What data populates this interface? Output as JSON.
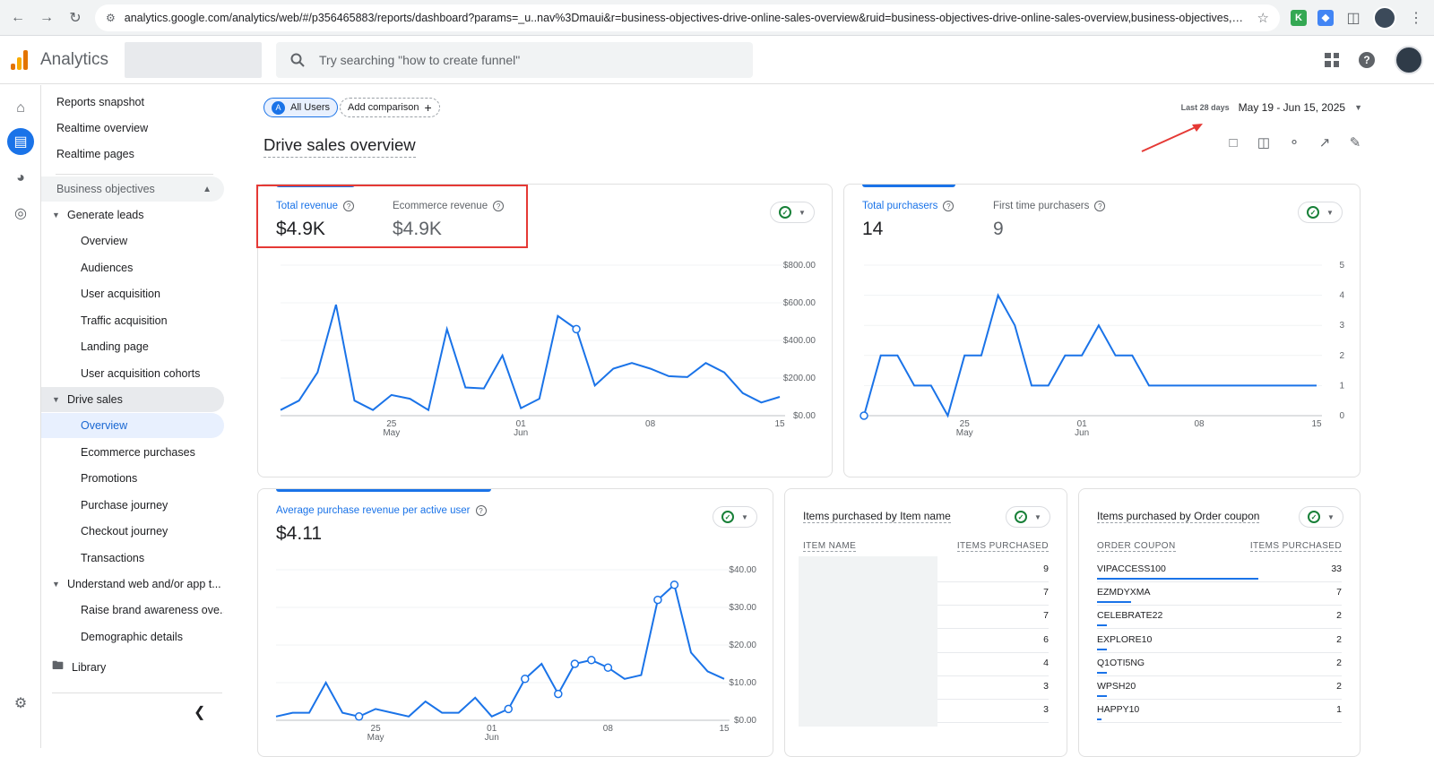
{
  "browser": {
    "url": "analytics.google.com/analytics/web/#/p356465883/reports/dashboard?params=_u..nav%3Dmaui&r=business-objectives-drive-online-sales-overview&ruid=business-objectives-drive-online-sales-overview,business-objectives,drive-online-sales..."
  },
  "header": {
    "app_title": "Analytics",
    "search_placeholder": "Try searching \"how to create funnel\""
  },
  "sidebar": {
    "top_items": [
      "Reports snapshot",
      "Realtime overview",
      "Realtime pages"
    ],
    "section": "Business objectives",
    "groups": [
      {
        "label": "Generate leads",
        "children": [
          "Overview",
          "Audiences",
          "User acquisition",
          "Traffic acquisition",
          "Landing page",
          "User acquisition cohorts"
        ]
      },
      {
        "label": "Drive sales",
        "children": [
          "Overview",
          "Ecommerce purchases",
          "Promotions",
          "Purchase journey",
          "Checkout journey",
          "Transactions"
        ]
      },
      {
        "label": "Understand web and/or app t...",
        "children": [
          "Raise brand awareness ove...",
          "Demographic details"
        ]
      }
    ],
    "library": "Library"
  },
  "main": {
    "comparison_chip": "All Users",
    "comparison_badge": "A",
    "add_comparison": "Add comparison",
    "date_label": "Last 28 days",
    "date_range": "May 19 - Jun 15, 2025",
    "page_title": "Drive sales overview"
  },
  "revenue_card": {
    "metrics": [
      {
        "label": "Total revenue",
        "value": "$4.9K"
      },
      {
        "label": "Ecommerce revenue",
        "value": "$4.9K"
      }
    ]
  },
  "purchasers_card": {
    "metrics": [
      {
        "label": "Total purchasers",
        "value": "14"
      },
      {
        "label": "First time purchasers",
        "value": "9"
      }
    ]
  },
  "arpu_card": {
    "label": "Average purchase revenue per active user",
    "value": "$4.11"
  },
  "items_table": {
    "title_prefix": "Items purchased by ",
    "title_dim": "Item name",
    "col1": "ITEM NAME",
    "col2": "ITEMS PURCHASED",
    "rows": [
      {
        "name": "",
        "value": "9"
      },
      {
        "name": "",
        "value": "7"
      },
      {
        "name": "",
        "value": "7"
      },
      {
        "name": "",
        "value": "6"
      },
      {
        "name": "",
        "value": "4"
      },
      {
        "name": "",
        "value": "3"
      },
      {
        "name": "",
        "value": "3"
      }
    ]
  },
  "coupon_table": {
    "title_prefix": "Items purchased by ",
    "title_dim": "Order coupon",
    "col1": "ORDER COUPON",
    "col2": "ITEMS PURCHASED",
    "rows": [
      {
        "name": "VIPACCESS100",
        "value": "33",
        "fraction": 1.0
      },
      {
        "name": "EZMDYXMA",
        "value": "7",
        "fraction": 0.21
      },
      {
        "name": "CELEBRATE22",
        "value": "2",
        "fraction": 0.06
      },
      {
        "name": "EXPLORE10",
        "value": "2",
        "fraction": 0.06
      },
      {
        "name": "Q1OTI5NG",
        "value": "2",
        "fraction": 0.06
      },
      {
        "name": "WPSH20",
        "value": "2",
        "fraction": 0.06
      },
      {
        "name": "HAPPY10",
        "value": "1",
        "fraction": 0.03
      }
    ]
  },
  "colors": {
    "accent": "#1a73e8",
    "annotation": "#e53935",
    "ok": "#188038"
  },
  "chart_data": [
    {
      "type": "line",
      "title": "Total revenue",
      "x": [
        "May 19",
        "May 20",
        "May 21",
        "May 22",
        "May 23",
        "May 24",
        "May 25",
        "May 26",
        "May 27",
        "May 28",
        "May 29",
        "May 30",
        "May 31",
        "Jun 1",
        "Jun 2",
        "Jun 3",
        "Jun 4",
        "Jun 5",
        "Jun 6",
        "Jun 7",
        "Jun 8",
        "Jun 9",
        "Jun 10",
        "Jun 11",
        "Jun 12",
        "Jun 13",
        "Jun 14",
        "Jun 15"
      ],
      "series": [
        {
          "values": [
            30,
            80,
            230,
            590,
            80,
            30,
            110,
            90,
            30,
            460,
            150,
            145,
            320,
            40,
            90,
            530,
            460,
            160,
            250,
            280,
            250,
            210,
            205,
            280,
            230,
            120,
            70,
            100
          ]
        }
      ],
      "x_tick_labels": [
        "25\nMay",
        "01\nJun",
        "08",
        "15"
      ],
      "y_tick_labels": [
        "$0.00",
        "$200.00",
        "$400.00",
        "$600.00",
        "$800.00"
      ],
      "ylim": [
        0,
        800
      ]
    },
    {
      "type": "line",
      "title": "Total purchasers",
      "x": [
        "May 19",
        "May 20",
        "May 21",
        "May 22",
        "May 23",
        "May 24",
        "May 25",
        "May 26",
        "May 27",
        "May 28",
        "May 29",
        "May 30",
        "May 31",
        "Jun 1",
        "Jun 2",
        "Jun 3",
        "Jun 4",
        "Jun 5",
        "Jun 6",
        "Jun 7",
        "Jun 8",
        "Jun 9",
        "Jun 10",
        "Jun 11",
        "Jun 12",
        "Jun 13",
        "Jun 14",
        "Jun 15"
      ],
      "series": [
        {
          "values": [
            0,
            2,
            2,
            1,
            1,
            0,
            2,
            2,
            4,
            3,
            1,
            1,
            2,
            2,
            3,
            2,
            2,
            1,
            1,
            1,
            1,
            1,
            1,
            1,
            1,
            1,
            1,
            1
          ]
        }
      ],
      "x_tick_labels": [
        "25\nMay",
        "01\nJun",
        "08",
        "15"
      ],
      "y_tick_labels": [
        "0",
        "1",
        "2",
        "3",
        "4",
        "5"
      ],
      "ylim": [
        0,
        5
      ]
    },
    {
      "type": "line",
      "title": "Average purchase revenue per active user",
      "x": [
        "May 19",
        "May 20",
        "May 21",
        "May 22",
        "May 23",
        "May 24",
        "May 25",
        "May 26",
        "May 27",
        "May 28",
        "May 29",
        "May 30",
        "May 31",
        "Jun 1",
        "Jun 2",
        "Jun 3",
        "Jun 4",
        "Jun 5",
        "Jun 6",
        "Jun 7",
        "Jun 8",
        "Jun 9",
        "Jun 10",
        "Jun 11",
        "Jun 12",
        "Jun 13",
        "Jun 14",
        "Jun 15"
      ],
      "series": [
        {
          "values": [
            1,
            2,
            2,
            10,
            2,
            1,
            3,
            2,
            1,
            5,
            2,
            2,
            6,
            1,
            3,
            11,
            15,
            7,
            15,
            16,
            14,
            11,
            12,
            32,
            36,
            18,
            13,
            11
          ]
        }
      ],
      "x_tick_labels": [
        "25\nMay",
        "01\nJun",
        "08",
        "15"
      ],
      "y_tick_labels": [
        "$0.00",
        "$10.00",
        "$20.00",
        "$30.00",
        "$40.00"
      ],
      "ylim": [
        0,
        40
      ]
    }
  ]
}
